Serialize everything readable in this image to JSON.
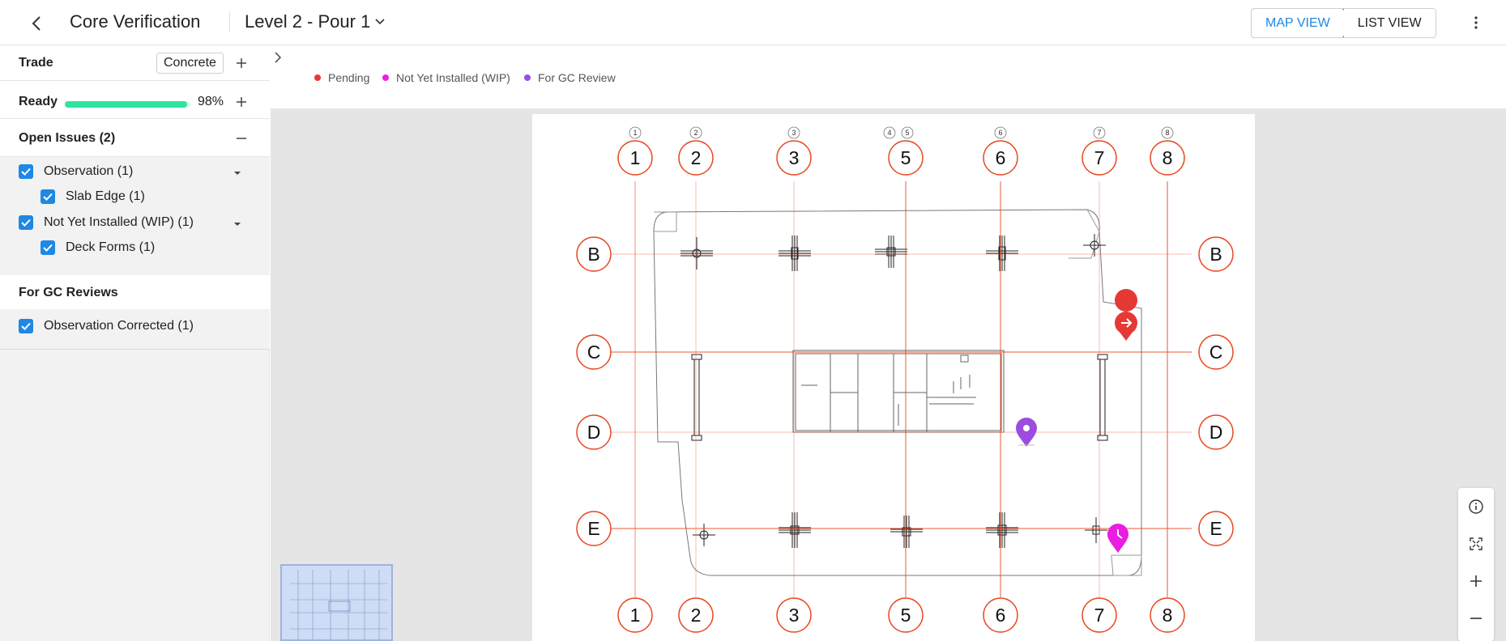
{
  "header": {
    "app_title": "Core Verification",
    "level": "Level 2 - Pour 1",
    "views": [
      "MAP VIEW",
      "LIST VIEW"
    ],
    "active_view": "MAP VIEW",
    "icons": {
      "back": "chevron-left-icon",
      "level_dropdown": "chevron-down-icon",
      "more": "vertical-dots-icon"
    }
  },
  "sidebar": {
    "trade": {
      "label": "Trade",
      "value": "Concrete"
    },
    "ready": {
      "label": "Ready",
      "percent_text": "98%",
      "percent": 98
    },
    "open_issues": {
      "label": "Open Issues (2)",
      "items": [
        {
          "label": "Observation (1)",
          "checked": true,
          "level": 0,
          "expandable": true
        },
        {
          "label": "Slab Edge (1)",
          "checked": true,
          "level": 1
        },
        {
          "label": "Not Yet Installed (WIP) (1)",
          "checked": true,
          "level": 0,
          "expandable": true
        },
        {
          "label": "Deck Forms (1)",
          "checked": true,
          "level": 1
        }
      ]
    },
    "gc_reviews": {
      "label": "For GC Reviews",
      "items": [
        {
          "label": "Observation Corrected (1)",
          "checked": true
        }
      ]
    }
  },
  "legend": [
    {
      "label": "Pending",
      "color": "#e53935"
    },
    {
      "label": "Not Yet Installed (WIP)",
      "color": "#e91ee0"
    },
    {
      "label": "For GC Review",
      "color": "#9c4de0"
    }
  ],
  "map": {
    "column_grid_labels": [
      "1",
      "2",
      "3",
      "5",
      "6",
      "7",
      "8"
    ],
    "row_grid_labels": [
      "B",
      "C",
      "D",
      "E"
    ],
    "top_small_labels": [
      "1",
      "2",
      "3",
      "4",
      "5",
      "6",
      "7",
      "8"
    ],
    "grid_color": "#e8471f",
    "markers": [
      {
        "status": "Pending",
        "icon": "arrow-right-icon",
        "color": "#e53935"
      },
      {
        "status": "For GC Review",
        "icon": "location-pin-icon",
        "color": "#9c4de0"
      },
      {
        "status": "Not Yet Installed (WIP)",
        "icon": "clock-icon",
        "color": "#e91ee0"
      }
    ]
  },
  "map_controls": [
    "info-icon",
    "fit-screen-icon",
    "zoom-in-icon",
    "zoom-out-icon"
  ]
}
